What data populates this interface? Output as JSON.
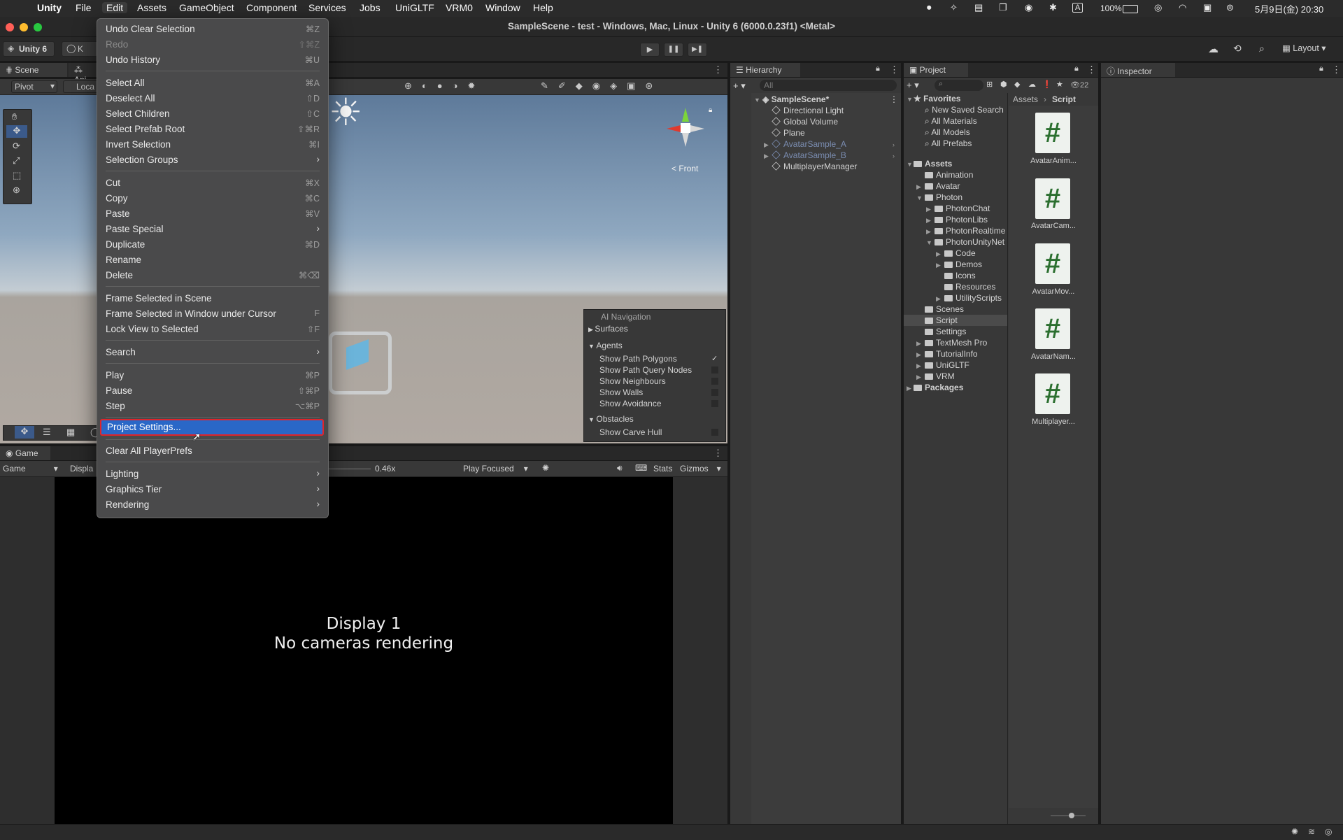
{
  "menubar": {
    "app": "Unity",
    "items": [
      "File",
      "Edit",
      "Assets",
      "GameObject",
      "Component",
      "Services",
      "Jobs",
      "UniGLTF",
      "VRM0",
      "Window",
      "Help"
    ],
    "battery": "100%",
    "datetime": "5月9日(金) 20:30",
    "input_indicator": "A"
  },
  "window_title": "SampleScene - test - Windows, Mac, Linux - Unity 6 (6000.0.23f1) <Metal>",
  "toolbar": {
    "unity_label": "Unity 6",
    "account_label": "K",
    "layout_label": "Layout"
  },
  "scene": {
    "tabs": [
      "Scene",
      "Ani"
    ],
    "pivot_label": "Pivot",
    "local_label": "Loca",
    "front_label": "< Front",
    "ai_navigation": {
      "title": "AI Navigation",
      "surfaces": "Surfaces",
      "agents": "Agents",
      "agent_options": [
        {
          "label": "Show Path Polygons",
          "checked": true
        },
        {
          "label": "Show Path Query Nodes",
          "checked": false
        },
        {
          "label": "Show Neighbours",
          "checked": false
        },
        {
          "label": "Show Walls",
          "checked": false
        },
        {
          "label": "Show Avoidance",
          "checked": false
        }
      ],
      "obstacles": "Obstacles",
      "obstacle_options": [
        {
          "label": "Show Carve Hull",
          "checked": false
        }
      ]
    }
  },
  "game": {
    "tab": "Game",
    "dropdown": "Game",
    "display_dropdown": "Displa",
    "scale": "0.46x",
    "play_focused": "Play Focused",
    "stats": "Stats",
    "gizmos": "Gizmos",
    "message_line1": "Display 1",
    "message_line2": "No cameras rendering"
  },
  "hierarchy": {
    "tab": "Hierarchy",
    "search_placeholder": "All",
    "scene": "SampleScene*",
    "items": [
      "Directional Light",
      "Global Volume",
      "Plane",
      "AvatarSample_A",
      "AvatarSample_B",
      "MultiplayerManager"
    ]
  },
  "project": {
    "tab": "Project",
    "count": "22",
    "favorites": "Favorites",
    "favorite_items": [
      "New Saved Search",
      "All Materials",
      "All Models",
      "All Prefabs"
    ],
    "assets": "Assets",
    "tree": [
      "Animation",
      "Avatar",
      "Photon",
      "PhotonChat",
      "PhotonLibs",
      "PhotonRealtime",
      "PhotonUnityNet",
      "Code",
      "Demos",
      "Icons",
      "Resources",
      "UtilityScripts",
      "Scenes",
      "Script",
      "Settings",
      "TextMesh Pro",
      "TutorialInfo",
      "UniGLTF",
      "VRM"
    ],
    "packages": "Packages",
    "breadcrumb": [
      "Assets",
      "Script"
    ],
    "files": [
      "AvatarAnim...",
      "AvatarCam...",
      "AvatarMov...",
      "AvatarNam...",
      "Multiplayer..."
    ]
  },
  "inspector": {
    "tab": "Inspector"
  },
  "edit_menu": {
    "items": [
      {
        "label": "Undo Clear Selection",
        "shortcut": "⌘Z"
      },
      {
        "label": "Redo",
        "shortcut": "⇧⌘Z",
        "disabled": true
      },
      {
        "label": "Undo History",
        "shortcut": "⌘U"
      },
      {
        "label": "Select All",
        "shortcut": "⌘A"
      },
      {
        "label": "Deselect All",
        "shortcut": "⇧D"
      },
      {
        "label": "Select Children",
        "shortcut": "⇧C"
      },
      {
        "label": "Select Prefab Root",
        "shortcut": "⇧⌘R"
      },
      {
        "label": "Invert Selection",
        "shortcut": "⌘I"
      },
      {
        "label": "Selection Groups",
        "submenu": true
      },
      {
        "label": "Cut",
        "shortcut": "⌘X"
      },
      {
        "label": "Copy",
        "shortcut": "⌘C"
      },
      {
        "label": "Paste",
        "shortcut": "⌘V"
      },
      {
        "label": "Paste Special",
        "submenu": true
      },
      {
        "label": "Duplicate",
        "shortcut": "⌘D"
      },
      {
        "label": "Rename",
        "shortcut": ""
      },
      {
        "label": "Delete",
        "shortcut": "⌘⌫"
      },
      {
        "label": "Frame Selected in Scene",
        "shortcut": ""
      },
      {
        "label": "Frame Selected in Window under Cursor",
        "shortcut": "F"
      },
      {
        "label": "Lock View to Selected",
        "shortcut": "⇧F"
      },
      {
        "label": "Search",
        "submenu": true
      },
      {
        "label": "Play",
        "shortcut": "⌘P"
      },
      {
        "label": "Pause",
        "shortcut": "⇧⌘P"
      },
      {
        "label": "Step",
        "shortcut": "⌥⌘P"
      },
      {
        "label": "Project Settings...",
        "shortcut": "",
        "highlighted": true
      },
      {
        "label": "Clear All PlayerPrefs",
        "shortcut": ""
      },
      {
        "label": "Lighting",
        "submenu": true
      },
      {
        "label": "Graphics Tier",
        "submenu": true
      },
      {
        "label": "Rendering",
        "submenu": true
      }
    ]
  }
}
